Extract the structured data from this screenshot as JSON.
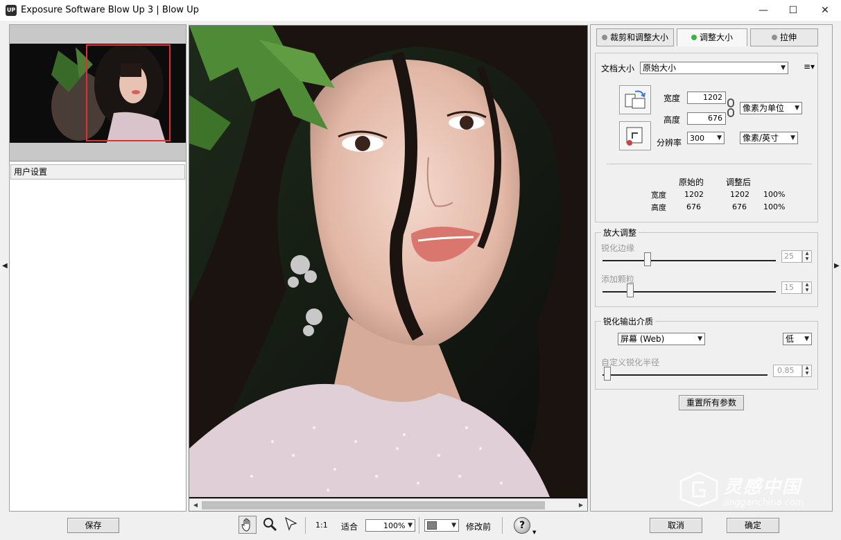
{
  "window": {
    "title": "Exposure Software Blow Up 3 | Blow Up",
    "icon_text": "UP",
    "minimize": "—",
    "maximize": "☐",
    "close": "✕"
  },
  "left": {
    "user_settings": "用户设置",
    "save_button": "保存"
  },
  "tabs": [
    {
      "label": "裁剪和调整大小"
    },
    {
      "label": "调整大小",
      "active": true
    },
    {
      "label": "拉伸"
    }
  ],
  "doc_size": {
    "label": "文档大小",
    "value": "原始大小",
    "width_label": "宽度",
    "width_value": "1202",
    "height_label": "高度",
    "height_value": "676",
    "unit": "像素为单位",
    "resolution_label": "分辨率",
    "resolution_value": "300",
    "resolution_unit": "像素/英寸"
  },
  "size_table": {
    "col_original": "原始的",
    "col_adjusted": "调整后",
    "rows": [
      {
        "label": "宽度",
        "original": "1202",
        "adjusted": "1202",
        "percent": "100%"
      },
      {
        "label": "高度",
        "original": "676",
        "adjusted": "676",
        "percent": "100%"
      }
    ]
  },
  "enlarge": {
    "title": "放大调整",
    "sharpen_label": "锐化边缘",
    "sharpen_value": "25",
    "grain_label": "添加颗粒",
    "grain_value": "15"
  },
  "output_sharpen": {
    "title": "锐化输出介质",
    "medium": "屏幕 (Web)",
    "level": "低",
    "radius_label": "自定义锐化半径",
    "radius_value": "0.85"
  },
  "reset_button": "重置所有参数",
  "toolbar": {
    "ratio_1_1": "1:1",
    "fit_label": "适合",
    "zoom_value": "100%",
    "before_label": "修改前",
    "help": "?"
  },
  "dialog": {
    "cancel": "取消",
    "ok": "确定"
  },
  "watermark": {
    "title": "灵感中国",
    "url": "lingganchina.com"
  },
  "colors": {
    "active_tab_dot": "#3cb043",
    "crop_rect": "#e03030"
  }
}
